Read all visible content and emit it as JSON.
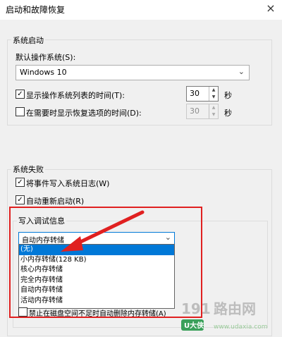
{
  "window": {
    "title": "启动和故障恢复",
    "close_icon": "×"
  },
  "system_startup": {
    "group_label": "系统启动",
    "default_os_label": "默认操作系统(S):",
    "default_os_value": "Windows 10",
    "show_os_list": {
      "label": "显示操作系统列表的时间(T):",
      "checked": true,
      "value": "30",
      "unit": "秒"
    },
    "show_recovery": {
      "label": "在需要时显示恢复选项的时间(D):",
      "checked": false,
      "value": "30",
      "unit": "秒"
    }
  },
  "system_failure": {
    "group_label": "系统失败",
    "write_event": {
      "label": "将事件写入系统日志(W)",
      "checked": true
    },
    "auto_restart": {
      "label": "自动重新启动(R)",
      "checked": true
    }
  },
  "debug_info": {
    "group_label": "写入调试信息",
    "selected": "自动内存转储",
    "options": [
      "(无)",
      "小内存转储(128 KB)",
      "核心内存转储",
      "完全内存转储",
      "自动内存转储",
      "活动内存转储"
    ],
    "highlighted_index": 0,
    "disable_auto_delete": {
      "label": "禁止在磁盘空间不足时自动删除内存转储(A)",
      "checked": false
    }
  },
  "watermark": {
    "number": "191",
    "brand": "路由网",
    "badge": "U大侠",
    "url": "www.udaxia.com"
  },
  "colors": {
    "highlight": "#0078d7",
    "annotation": "#e02020"
  }
}
